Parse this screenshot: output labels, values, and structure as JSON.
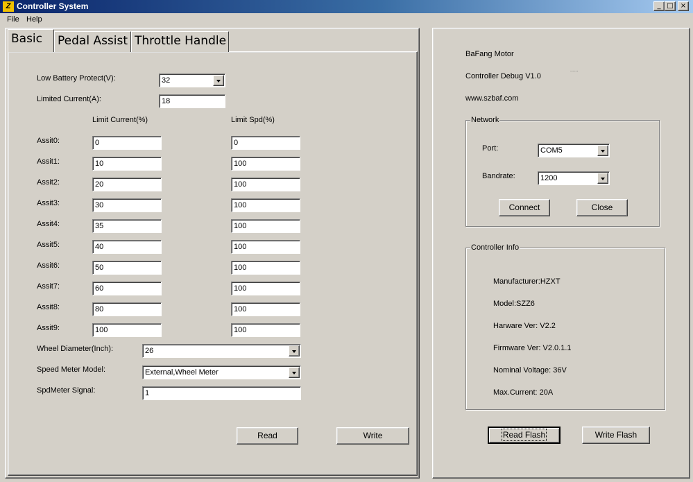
{
  "window": {
    "title": "Controller System",
    "icon_glyph": "Z",
    "controls": {
      "minimize": "_",
      "maximize": "□",
      "close": "×"
    }
  },
  "menu": [
    "File",
    "Help"
  ],
  "tabs": [
    {
      "label": "Basic",
      "active": true
    },
    {
      "label": "Pedal Assist",
      "active": false
    },
    {
      "label": "Throttle Handle",
      "active": false
    }
  ],
  "basic": {
    "low_battery_label": "Low Battery Protect(V):",
    "low_battery_value": "32",
    "limited_current_label": "Limited Current(A):",
    "limited_current_value": "18",
    "col_limit_current": "Limit Current(%)",
    "col_limit_spd": "Limit Spd(%)",
    "assist_rows": [
      {
        "label": "Assit0:",
        "current": "0",
        "spd": "0"
      },
      {
        "label": "Assit1:",
        "current": "10",
        "spd": "100"
      },
      {
        "label": "Assit2:",
        "current": "20",
        "spd": "100"
      },
      {
        "label": "Assit3:",
        "current": "30",
        "spd": "100"
      },
      {
        "label": "Assit4:",
        "current": "35",
        "spd": "100"
      },
      {
        "label": "Assit5:",
        "current": "40",
        "spd": "100"
      },
      {
        "label": "Assit6:",
        "current": "50",
        "spd": "100"
      },
      {
        "label": "Assit7:",
        "current": "60",
        "spd": "100"
      },
      {
        "label": "Assit8:",
        "current": "80",
        "spd": "100"
      },
      {
        "label": "Assit9:",
        "current": "100",
        "spd": "100"
      }
    ],
    "wheel_diameter_label": "Wheel Diameter(Inch):",
    "wheel_diameter_value": "26",
    "speed_meter_model_label": "Speed Meter Model:",
    "speed_meter_model_value": "External,Wheel Meter",
    "spdmeter_signal_label": "SpdMeter Signal:",
    "spdmeter_signal_value": "1",
    "read_button": "Read",
    "write_button": "Write"
  },
  "info_panel": {
    "brand": "BaFang Motor",
    "debug_version": "Controller Debug V1.0",
    "website": "www.szbaf.com",
    "stray_mark": "......"
  },
  "network": {
    "legend": "Network",
    "port_label": "Port:",
    "port_value": "COM5",
    "baudrate_label": "Bandrate:",
    "baudrate_value": "1200",
    "connect_button": "Connect",
    "close_button": "Close"
  },
  "controller_info": {
    "legend": "Controller Info",
    "lines": [
      "Manufacturer:HZXT",
      "Model:SZZ6",
      "Harware Ver: V2.2",
      "Firmware Ver: V2.0.1.1",
      "Nominal Voltage: 36V",
      "Max.Current: 20A"
    ]
  },
  "flash": {
    "read_button": "Read Flash",
    "write_button": "Write Flash"
  }
}
